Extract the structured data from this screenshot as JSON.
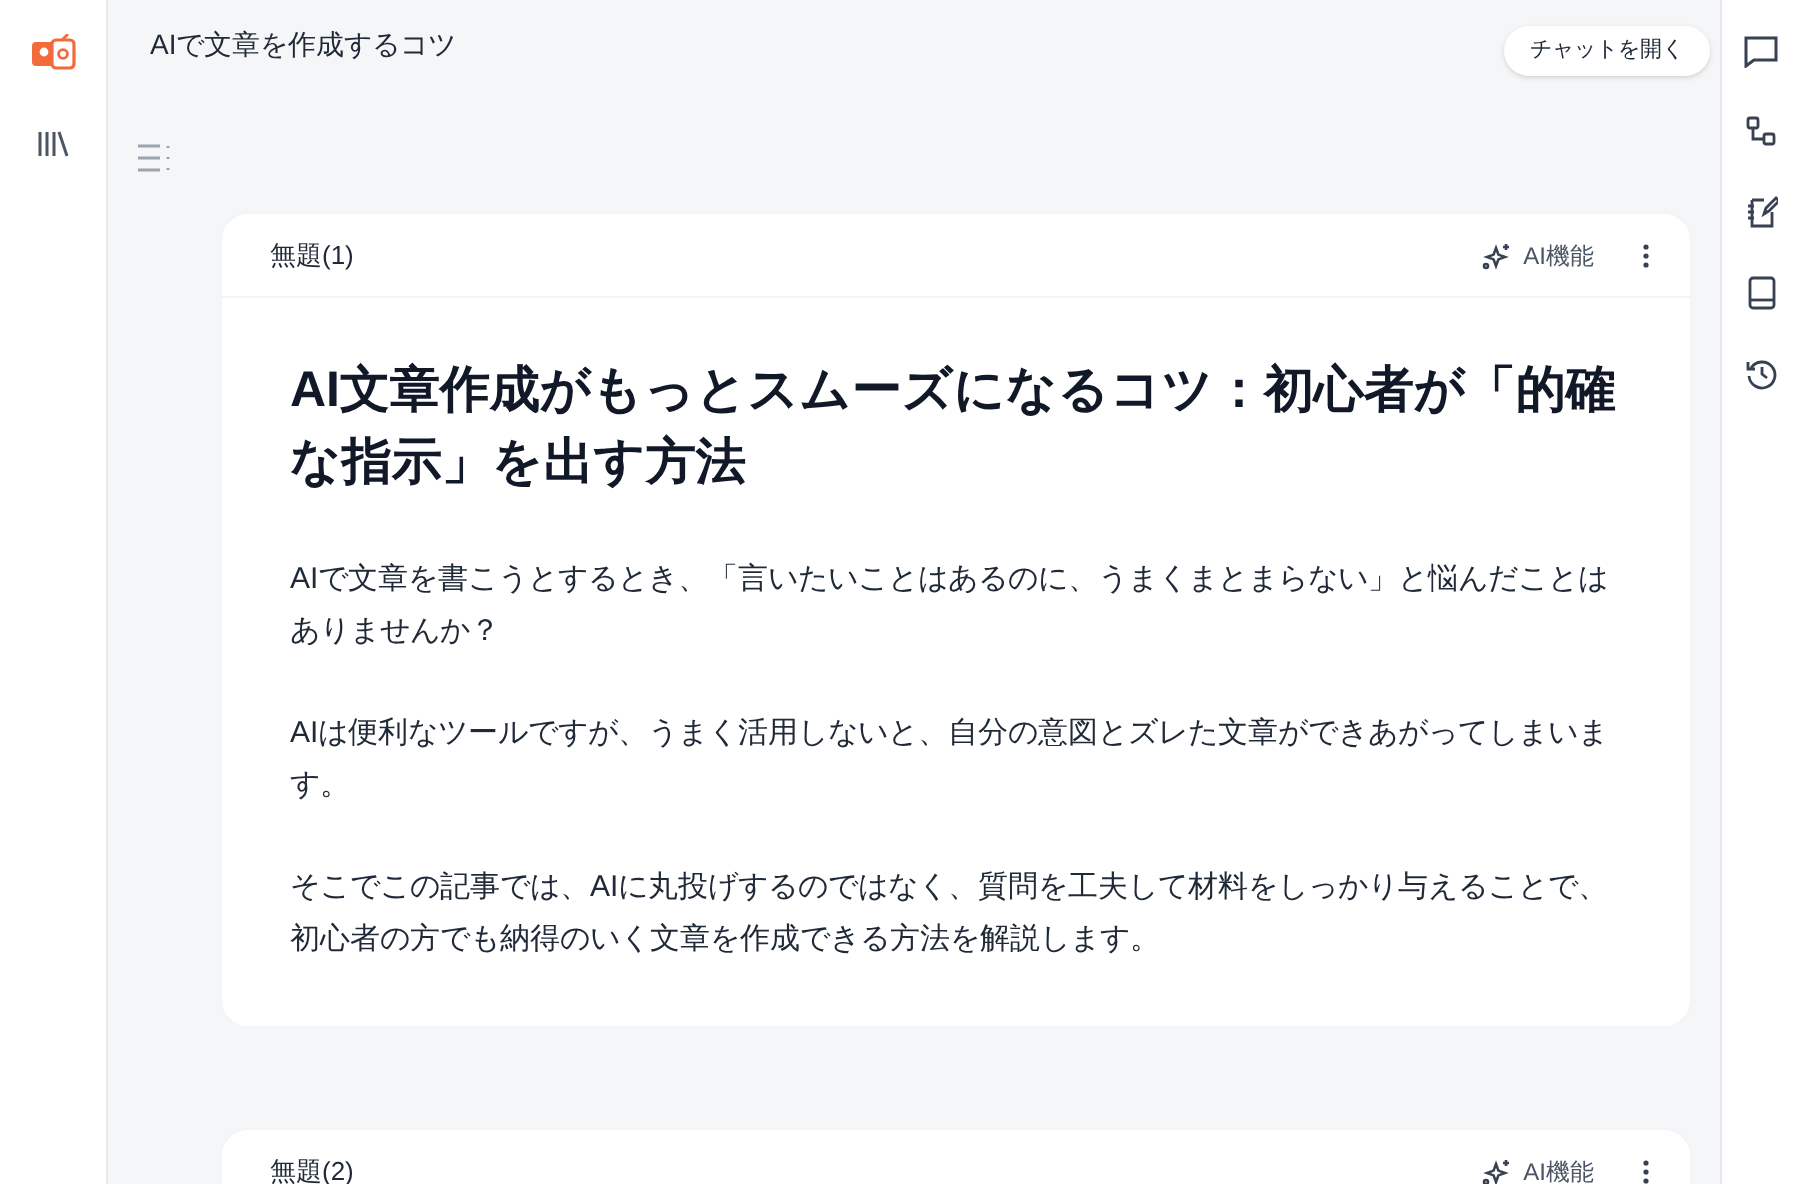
{
  "document_title": "AIで文章を作成するコツ",
  "tooltip": "チャットを開く",
  "cards": [
    {
      "title": "無題(1)",
      "ai_button": "AI機能",
      "heading": "AI文章作成がもっとスムーズになるコツ：初心者が「的確な指示」を出す方法",
      "paragraphs": [
        "AIで文章を書こうとするとき、「言いたいことはあるのに、うまくまとまらない」と悩んだことはありませんか？",
        "AIは便利なツールですが、うまく活用しないと、自分の意図とズレた文章ができあがってしまいます。",
        "そこでこの記事では、AIに丸投げするのではなく、質問を工夫して材料をしっかり与えることで、初心者の方でも納得のいく文章を作成できる方法を解説します。"
      ]
    },
    {
      "title": "無題(2)",
      "ai_button": "AI機能"
    }
  ]
}
